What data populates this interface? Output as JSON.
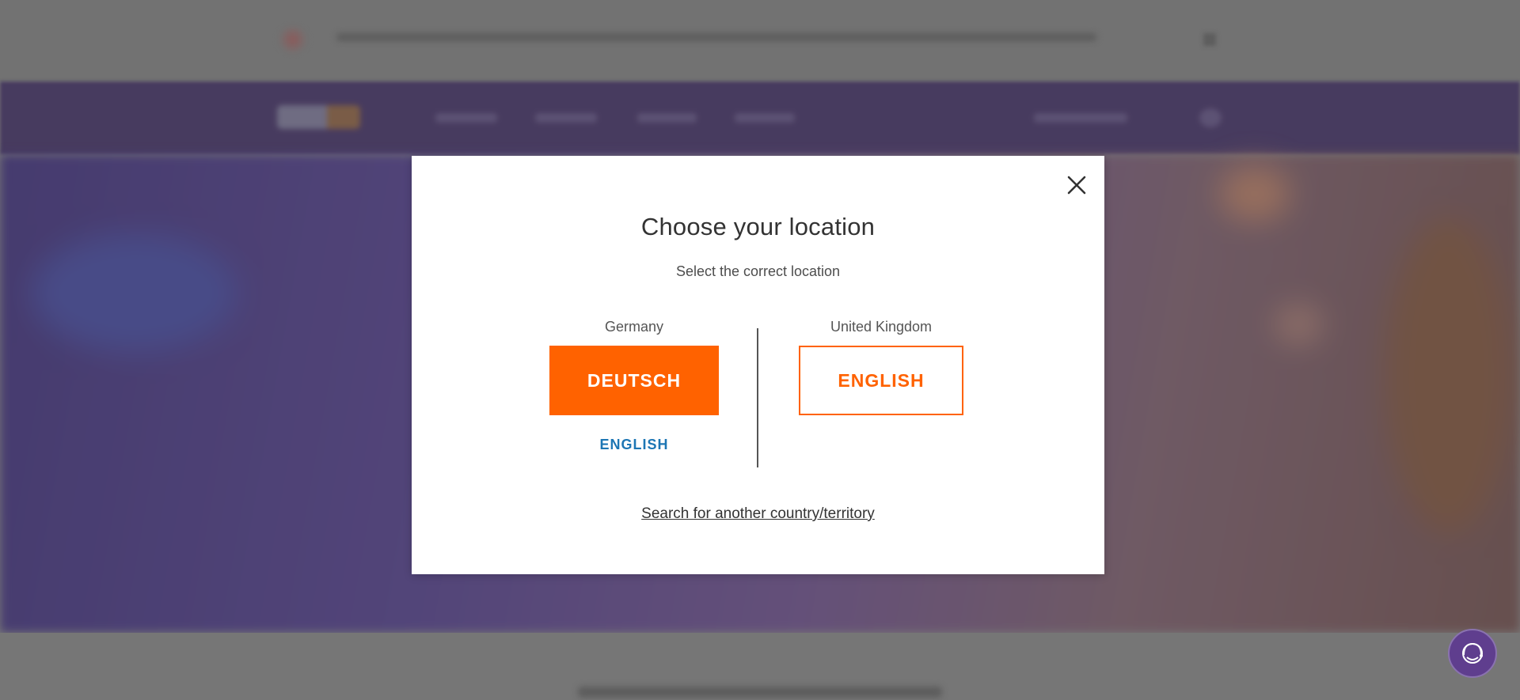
{
  "modal": {
    "title": "Choose your location",
    "subtitle": "Select the correct location",
    "left_column": {
      "country": "Germany",
      "primary_button": "DEUTSCH",
      "secondary_link": "ENGLISH"
    },
    "right_column": {
      "country": "United Kingdom",
      "button": "ENGLISH"
    },
    "search_link": "Search for another country/territory",
    "close_icon": "close-icon"
  },
  "chat": {
    "icon": "chat-agent-icon"
  },
  "colors": {
    "accent": "#ff6200",
    "link": "#1d76b4",
    "brand_purple": "#4d148c"
  }
}
